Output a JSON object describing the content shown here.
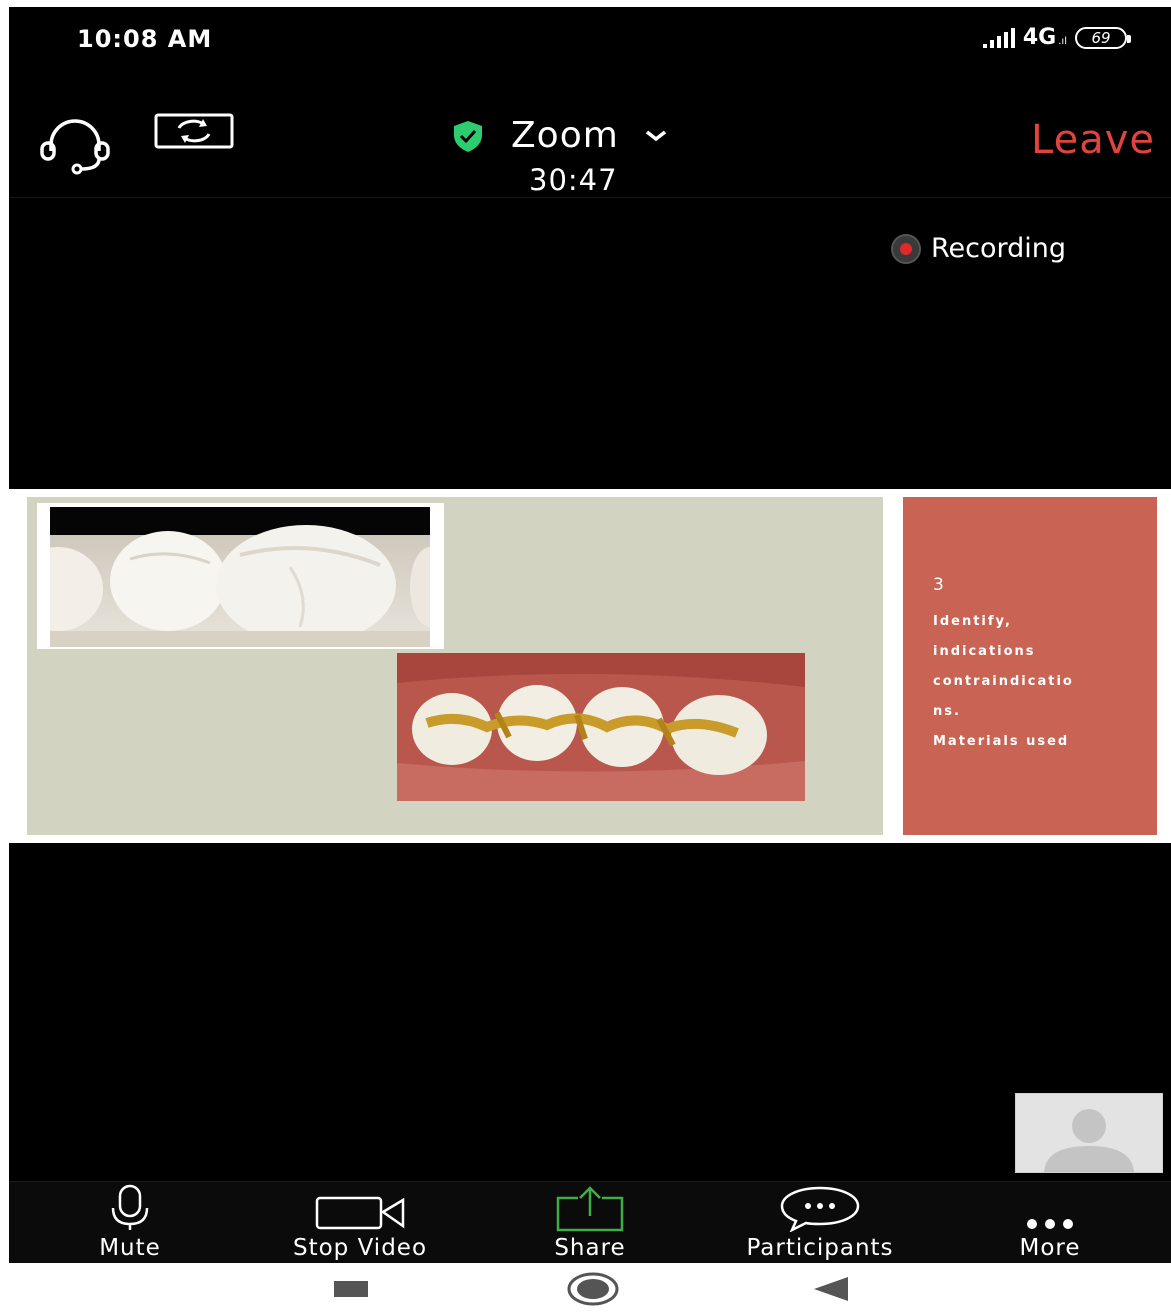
{
  "status_bar": {
    "time": "10:08 AM",
    "network": "4G",
    "network_sub": ".ıl",
    "battery": "69"
  },
  "header": {
    "meeting_title": "Zoom",
    "timer": "30:47",
    "leave_label": "Leave",
    "shield_color": "#2ecc71",
    "leave_color": "#e0443c"
  },
  "recording": {
    "label": "Recording"
  },
  "shared_slide": {
    "number": "3",
    "lines": [
      "Identify,",
      "indications",
      "contraindicatio",
      "ns.",
      "Materials used"
    ],
    "panel_color": "#c96455",
    "background_color": "#d2d3c0"
  },
  "toolbar": {
    "items": [
      {
        "label": "Mute",
        "icon": "microphone-icon"
      },
      {
        "label": "Stop Video",
        "icon": "video-camera-icon"
      },
      {
        "label": "Share",
        "icon": "share-icon"
      },
      {
        "label": "Participants",
        "icon": "chat-bubble-icon"
      },
      {
        "label": "More",
        "icon": "more-dots-icon"
      }
    ],
    "share_color": "#3fae49"
  },
  "nav": {
    "items": [
      "recents-icon",
      "home-icon",
      "back-icon"
    ]
  }
}
